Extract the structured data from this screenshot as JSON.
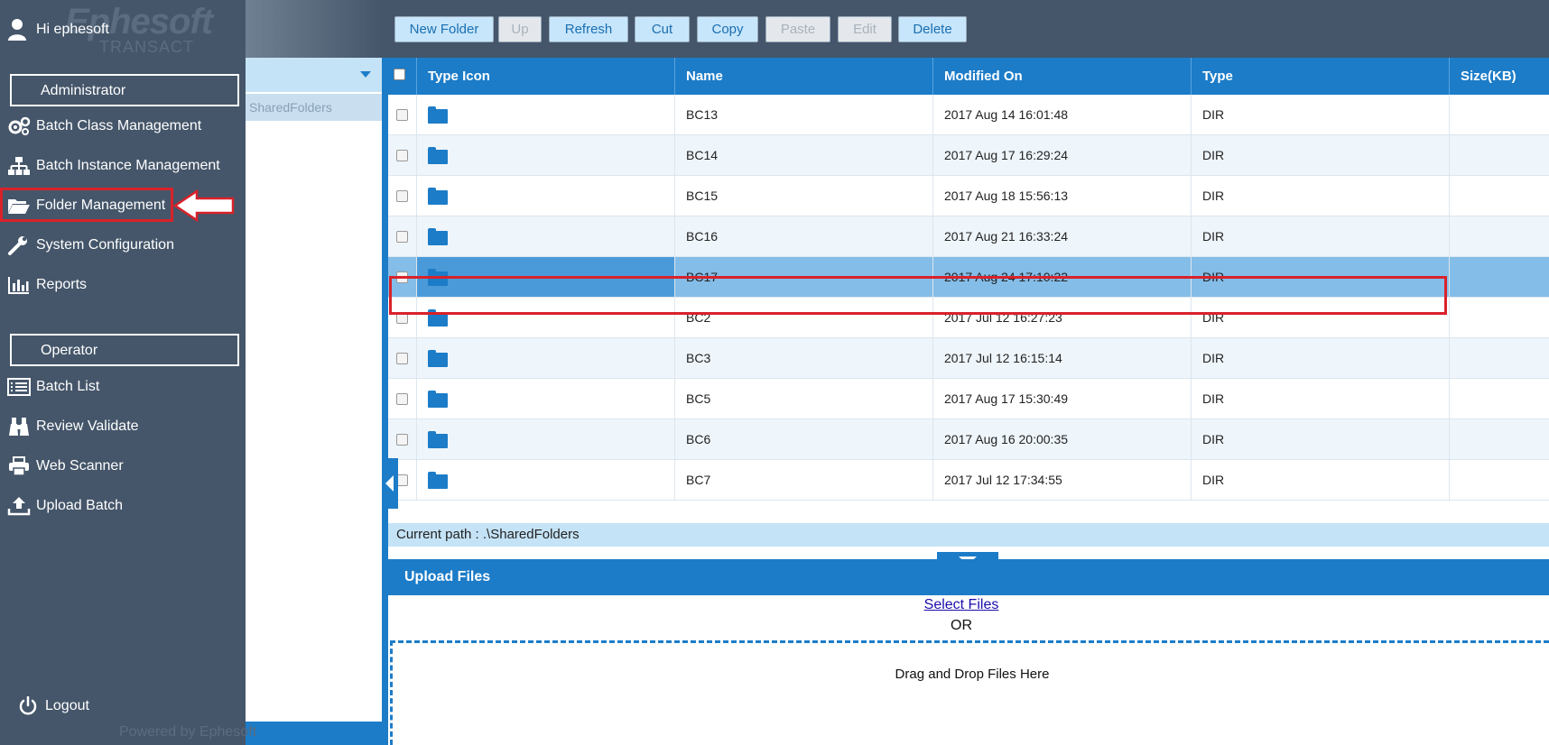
{
  "sidebar": {
    "brand": "Ephesoft",
    "brand_sub": "TRANSACT",
    "greeting": "Hi ephesoft",
    "admin_label": "Administrator",
    "admin_items": [
      {
        "label": "Batch Class Management",
        "icon": "gears-icon"
      },
      {
        "label": "Batch Instance Management",
        "icon": "sitemap-icon"
      },
      {
        "label": "Folder Management",
        "icon": "folder-open-icon"
      },
      {
        "label": "System Configuration",
        "icon": "wrench-icon"
      },
      {
        "label": "Reports",
        "icon": "bar-chart-icon"
      }
    ],
    "operator_label": "Operator",
    "operator_items": [
      {
        "label": "Batch List",
        "icon": "list-icon"
      },
      {
        "label": "Review Validate",
        "icon": "binoculars-icon"
      },
      {
        "label": "Web Scanner",
        "icon": "printer-icon"
      },
      {
        "label": "Upload Batch",
        "icon": "upload-icon"
      }
    ],
    "logout_label": "Logout",
    "powered_by": "Powered by Ephesoft"
  },
  "tree": {
    "root_node": "SharedFolders"
  },
  "toolbar": {
    "buttons": [
      {
        "label": "New Folder",
        "enabled": true
      },
      {
        "label": "Up",
        "enabled": false
      },
      {
        "label": "Refresh",
        "enabled": true
      },
      {
        "label": "Cut",
        "enabled": true
      },
      {
        "label": "Copy",
        "enabled": true
      },
      {
        "label": "Paste",
        "enabled": false
      },
      {
        "label": "Edit",
        "enabled": false
      },
      {
        "label": "Delete",
        "enabled": true
      }
    ]
  },
  "grid": {
    "columns": [
      "Type Icon",
      "Name",
      "Modified On",
      "Type",
      "Size(KB)"
    ],
    "rows": [
      {
        "name": "BC13",
        "modified": "2017 Aug 14 16:01:48",
        "type": "DIR",
        "size": ""
      },
      {
        "name": "BC14",
        "modified": "2017 Aug 17 16:29:24",
        "type": "DIR",
        "size": ""
      },
      {
        "name": "BC15",
        "modified": "2017 Aug 18 15:56:13",
        "type": "DIR",
        "size": ""
      },
      {
        "name": "BC16",
        "modified": "2017 Aug 21 16:33:24",
        "type": "DIR",
        "size": ""
      },
      {
        "name": "BC17",
        "modified": "2017 Aug 24 17:10:22",
        "type": "DIR",
        "size": "",
        "selected": true
      },
      {
        "name": "BC2",
        "modified": "2017 Jul 12 16:27:23",
        "type": "DIR",
        "size": ""
      },
      {
        "name": "BC3",
        "modified": "2017 Jul 12 16:15:14",
        "type": "DIR",
        "size": ""
      },
      {
        "name": "BC5",
        "modified": "2017 Aug 17 15:30:49",
        "type": "DIR",
        "size": ""
      },
      {
        "name": "BC6",
        "modified": "2017 Aug 16 20:00:35",
        "type": "DIR",
        "size": ""
      },
      {
        "name": "BC7",
        "modified": "2017 Jul 12 17:34:55",
        "type": "DIR",
        "size": ""
      }
    ],
    "current_path": "Current path : .\\SharedFolders"
  },
  "upload": {
    "header": "Upload Files",
    "select_files": "Select Files",
    "or": "OR",
    "drop_text": "Drag and Drop Files Here"
  },
  "colors": {
    "sidebar_bg": "#45566a",
    "accent_blue": "#1c7cc8",
    "highlight_red": "#d9222a",
    "selected_row": "#84bde8"
  }
}
